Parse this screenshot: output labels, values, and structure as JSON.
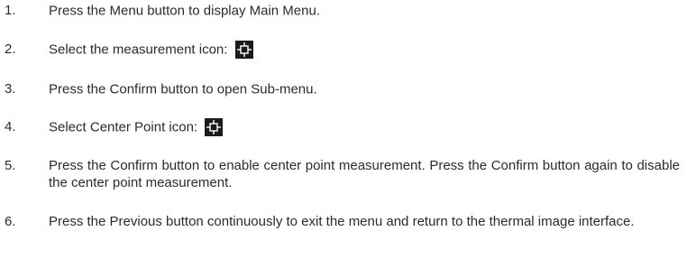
{
  "steps": [
    {
      "number": "1.",
      "text": "Press the Menu button to display Main Menu."
    },
    {
      "number": "2.",
      "text": "Select the measurement icon:",
      "icon": "crosshair-target-icon"
    },
    {
      "number": "3.",
      "text": "Press the Confirm button to open Sub-menu."
    },
    {
      "number": "4.",
      "text": "Select Center Point icon:",
      "icon": "crosshair-target-icon"
    },
    {
      "number": "5.",
      "text": "Press the Confirm button to enable center point measurement. Press the Confirm button again to disable the center point measurement."
    },
    {
      "number": "6.",
      "text": "Press the Previous button continuously to exit the menu and return to the thermal image interface."
    }
  ],
  "colors": {
    "text": "#2b2b2b",
    "icon_background": "#1b1b1b",
    "icon_foreground": "#ffffff"
  }
}
